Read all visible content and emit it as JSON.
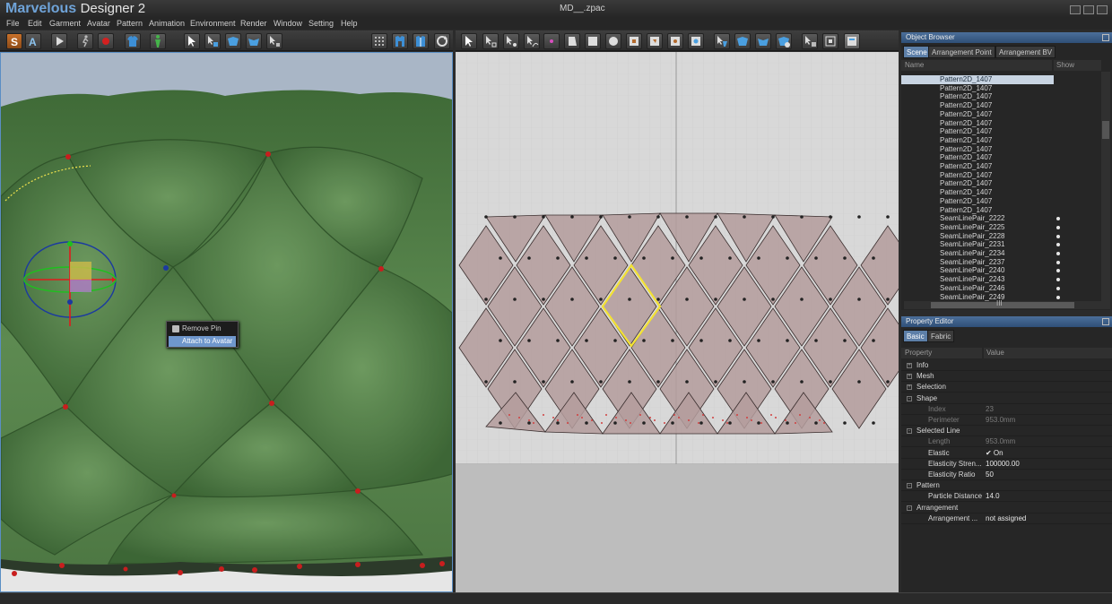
{
  "app": {
    "brand_main": "Marvelous",
    "brand_sub": "Designer 2",
    "document_title": "MD__.zpac"
  },
  "menu": [
    "File",
    "Edit",
    "Garment",
    "Avatar",
    "Pattern",
    "Animation",
    "Environment",
    "Render",
    "Window",
    "Setting",
    "Help"
  ],
  "context_menu": {
    "items": [
      {
        "label": "Remove Pin",
        "highlighted": false
      },
      {
        "label": "Attach to Avatar",
        "highlighted": true
      }
    ]
  },
  "object_browser": {
    "title": "Object Browser",
    "tabs": [
      {
        "label": "Scene",
        "active": true
      },
      {
        "label": "Arrangement Point",
        "active": false
      },
      {
        "label": "Arrangement BV",
        "active": false
      }
    ],
    "columns": [
      "Name",
      "Show"
    ],
    "rows": [
      {
        "name": "Pattern2D_1407",
        "show": false,
        "selected": true
      },
      {
        "name": "Pattern2D_1407",
        "show": false,
        "selected": false
      },
      {
        "name": "Pattern2D_1407",
        "show": false,
        "selected": false
      },
      {
        "name": "Pattern2D_1407",
        "show": false,
        "selected": false
      },
      {
        "name": "Pattern2D_1407",
        "show": false,
        "selected": false
      },
      {
        "name": "Pattern2D_1407",
        "show": false,
        "selected": false
      },
      {
        "name": "Pattern2D_1407",
        "show": false,
        "selected": false
      },
      {
        "name": "Pattern2D_1407",
        "show": false,
        "selected": false
      },
      {
        "name": "Pattern2D_1407",
        "show": false,
        "selected": false
      },
      {
        "name": "Pattern2D_1407",
        "show": false,
        "selected": false
      },
      {
        "name": "Pattern2D_1407",
        "show": false,
        "selected": false
      },
      {
        "name": "Pattern2D_1407",
        "show": false,
        "selected": false
      },
      {
        "name": "Pattern2D_1407",
        "show": false,
        "selected": false
      },
      {
        "name": "Pattern2D_1407",
        "show": false,
        "selected": false
      },
      {
        "name": "Pattern2D_1407",
        "show": false,
        "selected": false
      },
      {
        "name": "Pattern2D_1407",
        "show": false,
        "selected": false
      },
      {
        "name": "SeamLinePair_2222",
        "show": true,
        "selected": false
      },
      {
        "name": "SeamLinePair_2225",
        "show": true,
        "selected": false
      },
      {
        "name": "SeamLinePair_2228",
        "show": true,
        "selected": false
      },
      {
        "name": "SeamLinePair_2231",
        "show": true,
        "selected": false
      },
      {
        "name": "SeamLinePair_2234",
        "show": true,
        "selected": false
      },
      {
        "name": "SeamLinePair_2237",
        "show": true,
        "selected": false
      },
      {
        "name": "SeamLinePair_2240",
        "show": true,
        "selected": false
      },
      {
        "name": "SeamLinePair_2243",
        "show": true,
        "selected": false
      },
      {
        "name": "SeamLinePair_2246",
        "show": true,
        "selected": false
      },
      {
        "name": "SeamLinePair_2249",
        "show": true,
        "selected": false
      }
    ],
    "hscroll_label": "III"
  },
  "property_editor": {
    "title": "Property Editor",
    "tabs": [
      {
        "label": "Basic",
        "active": true
      },
      {
        "label": "Fabric",
        "active": false
      }
    ],
    "columns": [
      "Property",
      "Value"
    ],
    "rows": [
      {
        "key": "Info",
        "value": "",
        "level": 0,
        "toggle": "+",
        "dim": false
      },
      {
        "key": "Mesh",
        "value": "",
        "level": 0,
        "toggle": "+",
        "dim": false
      },
      {
        "key": "Selection",
        "value": "",
        "level": 0,
        "toggle": "+",
        "dim": false
      },
      {
        "key": "Shape",
        "value": "",
        "level": 0,
        "toggle": "-",
        "dim": false
      },
      {
        "key": "Index",
        "value": "23",
        "level": 1,
        "toggle": "",
        "dim": true
      },
      {
        "key": "Perimeter",
        "value": "953.0mm",
        "level": 1,
        "toggle": "",
        "dim": true
      },
      {
        "key": "Selected Line",
        "value": "",
        "level": 0,
        "toggle": "-",
        "dim": false
      },
      {
        "key": "Length",
        "value": "953.0mm",
        "level": 1,
        "toggle": "",
        "dim": true
      },
      {
        "key": "Elastic",
        "value": "✔  On",
        "level": 1,
        "toggle": "",
        "dim": false
      },
      {
        "key": "Elasticity Stren...",
        "value": "100000.00",
        "level": 1,
        "toggle": "",
        "dim": false
      },
      {
        "key": "Elasticity Ratio",
        "value": "50",
        "level": 1,
        "toggle": "",
        "dim": false
      },
      {
        "key": "Pattern",
        "value": "",
        "level": 0,
        "toggle": "-",
        "dim": false
      },
      {
        "key": "Particle Distance",
        "value": "14.0",
        "level": 1,
        "toggle": "",
        "dim": false
      },
      {
        "key": "Arrangement",
        "value": "",
        "level": 0,
        "toggle": "-",
        "dim": false
      },
      {
        "key": "Arrangement ...",
        "value": "not assigned",
        "level": 1,
        "toggle": "",
        "dim": false
      }
    ]
  },
  "toolbar_icons": {
    "left": [
      "simulation-S-icon",
      "avatar-A-icon",
      "play-icon",
      "walk-icon",
      "record-icon",
      "garment-icon",
      "avatar-figure-icon",
      "select-icon",
      "move-icon",
      "fold-icon",
      "fold-icon",
      "pin-icon",
      "cloth-dots-icon",
      "shirt-icon",
      "shirt-icon",
      "refresh-icon"
    ],
    "right": [
      "select-icon",
      "transform-icon",
      "edit-point-icon",
      "curve-icon",
      "add-point-icon",
      "polygon-icon",
      "rectangle-icon",
      "circle-icon",
      "internal-rect-icon",
      "internal-polygon-icon",
      "dart-icon",
      "hole-icon",
      "segment-sew-icon",
      "free-sew-icon",
      "fold-icon",
      "check-sew-icon",
      "text-icon",
      "pin-icon",
      "texture-icon",
      "settings-icon"
    ]
  },
  "colors": {
    "accent": "#5d7fa8",
    "garment_green": "#4f7a45",
    "pattern_fill": "#b49c9c",
    "selected_outline": "#f3e233"
  }
}
